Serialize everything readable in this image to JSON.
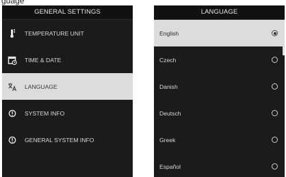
{
  "caption": "guage",
  "left_panel": {
    "title": "GENERAL SETTINGS",
    "items": [
      {
        "label": "TEMPERATURE UNIT",
        "icon": "thermometer-icon",
        "selected": false
      },
      {
        "label": "TIME & DATE",
        "icon": "calendar-clock-icon",
        "selected": false
      },
      {
        "label": "LANGUAGE",
        "icon": "translate-icon",
        "selected": true
      },
      {
        "label": "SYSTEM INFO",
        "icon": "info-icon",
        "selected": false
      },
      {
        "label": "GENERAL SYSTEM INFO",
        "icon": "info-icon",
        "selected": false
      }
    ]
  },
  "right_panel": {
    "title": "LANGUAGE",
    "languages": [
      {
        "label": "English",
        "checked": true
      },
      {
        "label": "Czech",
        "checked": false
      },
      {
        "label": "Danish",
        "checked": false
      },
      {
        "label": "Deutsch",
        "checked": false
      },
      {
        "label": "Greek",
        "checked": false
      },
      {
        "label": "Español",
        "checked": false
      }
    ]
  },
  "colors": {
    "screen_bg": "#1b1b1b",
    "header_bg": "#111111",
    "selected_bg": "#dcdcdc",
    "text": "#d8d8d8"
  }
}
